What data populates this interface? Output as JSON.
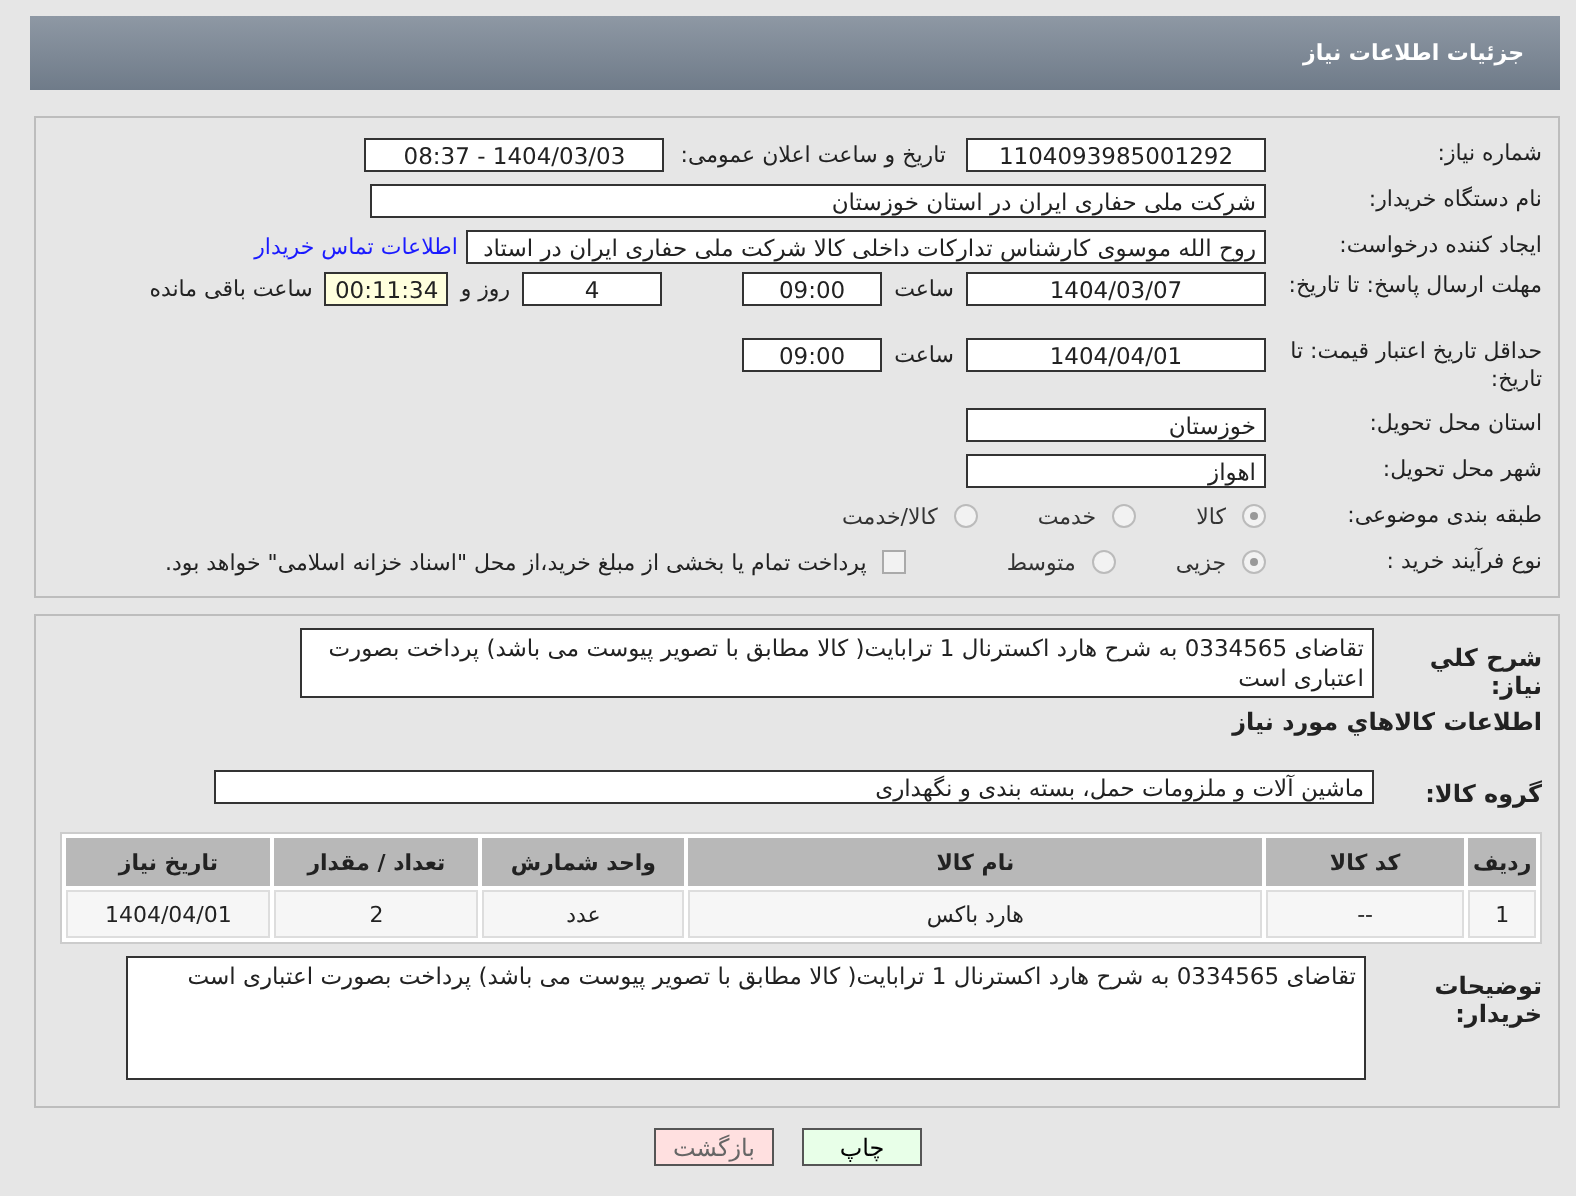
{
  "header": {
    "title": "جزئیات اطلاعات نیاز"
  },
  "need_number": {
    "label": "شماره نیاز:",
    "value": "1104093985001292"
  },
  "announce": {
    "label": "تاریخ و ساعت اعلان عمومی:",
    "value": "1404/03/03 - 08:37"
  },
  "buyer_org": {
    "label": "نام دستگاه خریدار:",
    "value": "شرکت ملی حفاری ایران در استان خوزستان"
  },
  "requester": {
    "label": "ایجاد کننده درخواست:",
    "value": "روح الله موسوی کارشناس تدارکات داخلی کالا شرکت ملی حفاری ایران در استاد",
    "link": "اطلاعات تماس خریدار"
  },
  "reply_deadline": {
    "label": "مهلت ارسال پاسخ: تا تاریخ:",
    "date": "1404/03/07",
    "time_label": "ساعت",
    "time": "09:00",
    "days": "4",
    "days_label": "روز و",
    "remaining": "00:11:34",
    "remaining_label": "ساعت باقی مانده"
  },
  "price_validity": {
    "label": "حداقل تاریخ اعتبار قیمت: تا تاریخ:",
    "date": "1404/04/01",
    "time_label": "ساعت",
    "time": "09:00"
  },
  "province": {
    "label": "استان محل تحویل:",
    "value": "خوزستان"
  },
  "city": {
    "label": "شهر محل تحویل:",
    "value": "اهواز"
  },
  "category": {
    "label": "طبقه بندی موضوعی:",
    "options": [
      {
        "label": "کالا",
        "selected": true
      },
      {
        "label": "خدمت",
        "selected": false
      },
      {
        "label": "کالا/خدمت",
        "selected": false
      }
    ]
  },
  "purchase_process": {
    "label": "نوع فرآیند خرید :",
    "options": [
      {
        "label": "جزیی",
        "selected": true
      },
      {
        "label": "متوسط",
        "selected": false
      }
    ],
    "treasury": {
      "label": "پرداخت تمام یا بخشی از مبلغ خرید،از محل \"اسناد خزانه اسلامی\" خواهد بود.",
      "checked": false
    }
  },
  "description": {
    "label": "شرح کلي نياز:",
    "value": "تقاضای 0334565 به شرح هارد اکسترنال 1 ترابایت( کالا مطابق با تصویر پیوست می باشد) پرداخت بصورت اعتباری است"
  },
  "goods_section": {
    "title": "اطلاعات کالاهاي مورد نياز"
  },
  "goods_group": {
    "label": "گروه کالا:",
    "value": "ماشین آلات و ملزومات حمل، بسته بندی و نگهداری"
  },
  "table": {
    "columns": [
      "ردیف",
      "کد کالا",
      "نام کالا",
      "واحد شمارش",
      "تعداد / مقدار",
      "تاریخ نیاز"
    ],
    "rows": [
      [
        "1",
        "--",
        "هارد باکس",
        "عدد",
        "2",
        "1404/04/01"
      ]
    ]
  },
  "buyer_notes": {
    "label": "توضیحات خریدار:",
    "value": "تقاضای 0334565 به شرح هارد اکسترنال 1 ترابایت( کالا مطابق با تصویر پیوست می باشد) پرداخت بصورت اعتباری است"
  },
  "buttons": [
    {
      "label": "چاپ",
      "kind": "print"
    },
    {
      "label": "بازگشت",
      "kind": "back"
    }
  ]
}
